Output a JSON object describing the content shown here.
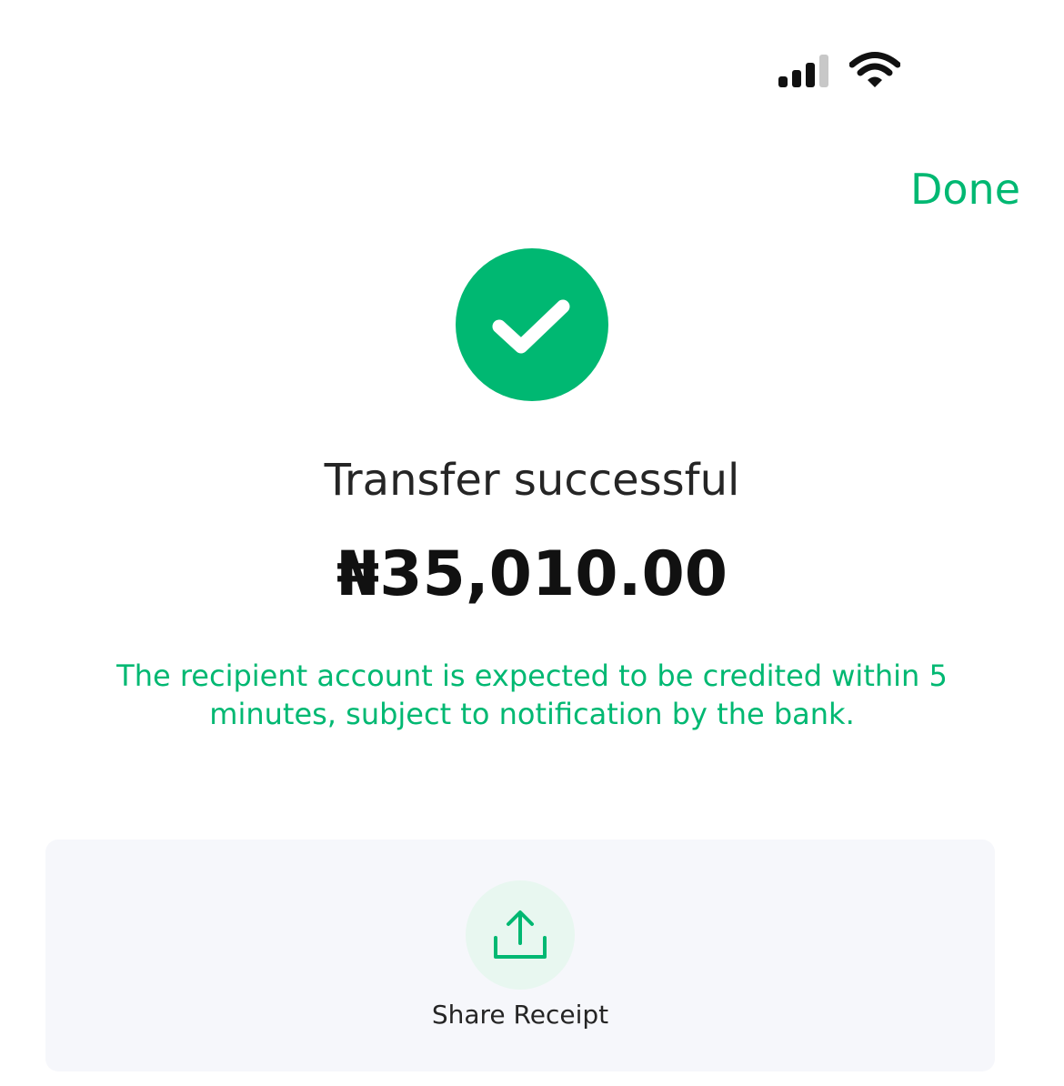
{
  "status_bar": {
    "signal_icon": "cellular-signal-icon",
    "wifi_icon": "wifi-icon"
  },
  "header": {
    "done_label": "Done"
  },
  "result": {
    "status_icon": "checkmark-icon",
    "title": "Transfer successful",
    "amount": "₦35,010.00",
    "note": "The recipient account is expected to be credited within 5 minutes, subject to notification by the bank."
  },
  "actions": {
    "share_icon": "share-upload-icon",
    "share_label": "Share Receipt"
  },
  "colors": {
    "accent": "#00b872",
    "accent_light": "#e8f7f0",
    "card_background": "#f6f7fb",
    "text_primary": "#252525"
  }
}
